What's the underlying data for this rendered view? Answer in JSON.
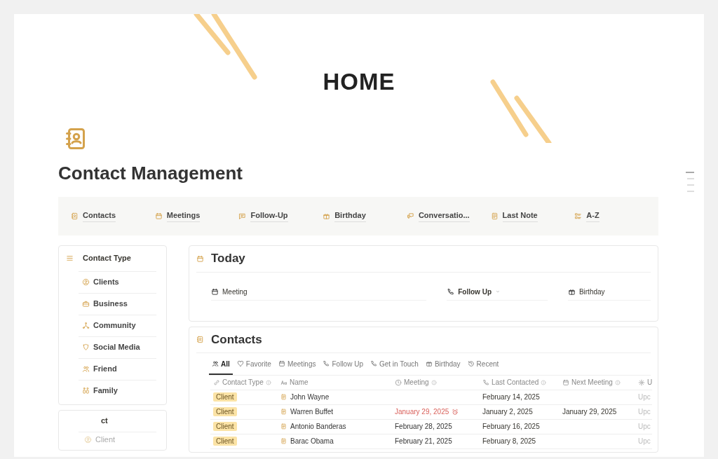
{
  "header": {
    "title": "HOME"
  },
  "page": {
    "title": "Contact Management"
  },
  "nav": [
    {
      "label": "Contacts"
    },
    {
      "label": "Meetings"
    },
    {
      "label": "Follow-Up"
    },
    {
      "label": "Birthday"
    },
    {
      "label": "Conversatio..."
    },
    {
      "label": "Last Note"
    },
    {
      "label": "A-Z"
    }
  ],
  "sidebar": {
    "heading": "Contact Type",
    "items": [
      {
        "label": "Clients"
      },
      {
        "label": "Business"
      },
      {
        "label": "Community"
      },
      {
        "label": "Social Media"
      },
      {
        "label": "Friend"
      },
      {
        "label": "Family"
      }
    ],
    "second_card": {
      "heading": "ct",
      "items": [
        {
          "label": "Client"
        }
      ]
    }
  },
  "today": {
    "title": "Today",
    "sections": [
      {
        "label": "Meeting",
        "dropdown": false
      },
      {
        "label": "Follow Up",
        "dropdown": true
      },
      {
        "label": "Birthday",
        "dropdown": false
      }
    ]
  },
  "contacts": {
    "title": "Contacts",
    "tabs": [
      {
        "label": "All",
        "selected": true
      },
      {
        "label": "Favorite",
        "selected": false
      },
      {
        "label": "Meetings",
        "selected": false
      },
      {
        "label": "Follow Up",
        "selected": false
      },
      {
        "label": "Get in Touch",
        "selected": false
      },
      {
        "label": "Birthday",
        "selected": false
      },
      {
        "label": "Recent",
        "selected": false
      }
    ],
    "table": {
      "columns": [
        {
          "label": "Contact Type",
          "info": true
        },
        {
          "label": "Name",
          "info": false
        },
        {
          "label": "Meeting",
          "info": true
        },
        {
          "label": "Last Contacted",
          "info": true
        },
        {
          "label": "Next Meeting",
          "info": true
        },
        {
          "label": "U"
        }
      ],
      "rows": [
        {
          "contact_type": "Client",
          "name": "John Wayne",
          "meeting": "",
          "meeting_overdue": false,
          "last_contacted": "February 14, 2025",
          "next_meeting": "",
          "column_6": "Upc"
        },
        {
          "contact_type": "Client",
          "name": "Warren Buffet",
          "meeting": "January 29, 2025",
          "meeting_overdue": true,
          "last_contacted": "January 2, 2025",
          "next_meeting": "January 29, 2025",
          "column_6": "Upc"
        },
        {
          "contact_type": "Client",
          "name": "Antonio Banderas",
          "meeting": "February 28, 2025",
          "meeting_overdue": false,
          "last_contacted": "February 16, 2025",
          "next_meeting": "",
          "column_6": "Upc"
        },
        {
          "contact_type": "Client",
          "name": "Barac Obama",
          "meeting": "February 21, 2025",
          "meeting_overdue": false,
          "last_contacted": "February 8, 2025",
          "next_meeting": "",
          "column_6": "Upc"
        }
      ]
    }
  }
}
